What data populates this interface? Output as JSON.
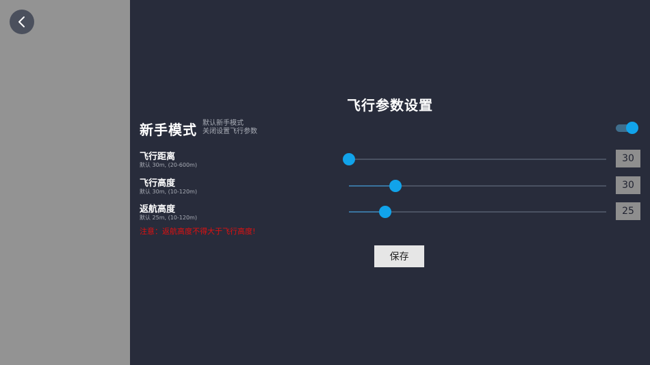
{
  "title": "飞行参数设置",
  "novice_mode": {
    "label": "新手模式",
    "desc_line1": "默认新手模式",
    "desc_line2": "关闭设置飞行参数",
    "enabled": true
  },
  "settings": [
    {
      "label": "飞行距离",
      "sub": "默认 30m, (20-600m)",
      "value": "30",
      "slider_fraction": 0.0
    },
    {
      "label": "飞行高度",
      "sub": "默认 30m, (10-120m)",
      "value": "30",
      "slider_fraction": 0.18
    },
    {
      "label": "返航高度",
      "sub": "默认 25m, (10-120m)",
      "value": "25",
      "slider_fraction": 0.14
    }
  ],
  "warning": "注意：返航高度不得大于飞行高度!",
  "save_label": "保存",
  "icons": {
    "back": "back-arrow-icon"
  },
  "colors": {
    "accent": "#11a3ea",
    "warning": "#e01010",
    "background": "#282c3b",
    "left_panel": "#939393"
  }
}
